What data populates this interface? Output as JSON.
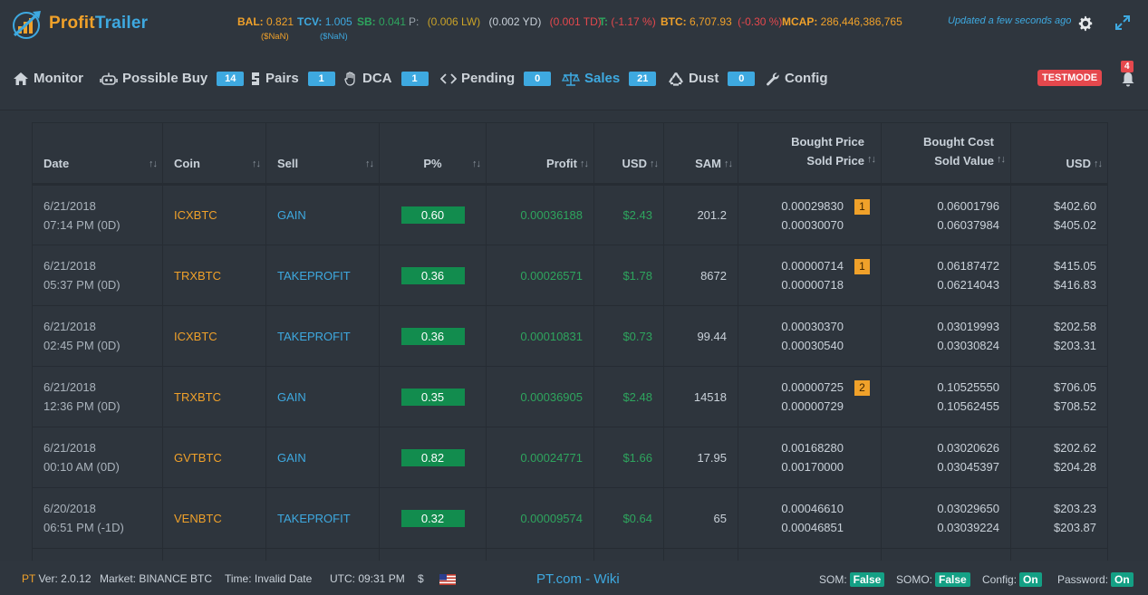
{
  "app": {
    "logo_part1": "Profit",
    "logo_part2": "Trailer",
    "brand_orange": "#f0a12a",
    "brand_blue": "#3ea9e0"
  },
  "header": {
    "bal_label": "BAL:",
    "bal_value": "0.821",
    "bal_sub": "($NaN)",
    "tcv_label": "TCV:",
    "tcv_value": "1.005",
    "tcv_sub": "($NaN)",
    "sb_label": "SB:",
    "sb_value": "0.041",
    "p_label": "P:",
    "p_lw": "(0.006 LW)",
    "p_yd": "(0.002 YD)",
    "p_td": "(0.001 TD)",
    "t_label": "T:",
    "t_value": "(-1.17 %)",
    "btc_label": "BTC:",
    "btc_value": "6,707.93",
    "btc_change": "(-0.30 %)",
    "mcap_label": "MCAP:",
    "mcap_value": "286,446,386,765",
    "updated": "Updated a few seconds ago"
  },
  "nav": {
    "items": [
      {
        "label": "Monitor",
        "badge": null,
        "icon": "home-icon"
      },
      {
        "label": "Possible Buy",
        "badge": "14",
        "icon": "robot-icon"
      },
      {
        "label": "Pairs",
        "badge": "1",
        "icon": "pairs-icon"
      },
      {
        "label": "DCA",
        "badge": "1",
        "icon": "hand-icon"
      },
      {
        "label": "Pending",
        "badge": "0",
        "icon": "pending-icon"
      },
      {
        "label": "Sales",
        "badge": "21",
        "icon": "balance-scale-icon"
      },
      {
        "label": "Dust",
        "badge": "0",
        "icon": "recycle-icon"
      },
      {
        "label": "Config",
        "badge": null,
        "icon": "wrench-icon"
      }
    ],
    "testmode": "TESTMODE",
    "notifications": "4"
  },
  "table": {
    "headers": {
      "date": "Date",
      "coin": "Coin",
      "sell": "Sell",
      "pct": "P%",
      "profit": "Profit",
      "usd": "USD",
      "sam": "SAM",
      "price_top": "Bought Price",
      "price_bottom": "Sold Price",
      "cost_top": "Bought Cost",
      "cost_bottom": "Sold Value",
      "usd2": "USD"
    },
    "rows": [
      {
        "date": "6/21/2018",
        "time": "07:14 PM (0D)",
        "coin": "ICXBTC",
        "sell": "GAIN",
        "pct": "0.60",
        "profit": "0.00036188",
        "usd": "$2.43",
        "sam": "201.2",
        "bought_price": "0.00029830",
        "sold_price": "0.00030070",
        "dca": "1",
        "bought_cost": "0.06001796",
        "sold_value": "0.06037984",
        "usd_bought": "$402.60",
        "usd_sold": "$405.02"
      },
      {
        "date": "6/21/2018",
        "time": "05:37 PM (0D)",
        "coin": "TRXBTC",
        "sell": "TAKEPROFIT",
        "pct": "0.36",
        "profit": "0.00026571",
        "usd": "$1.78",
        "sam": "8672",
        "bought_price": "0.00000714",
        "sold_price": "0.00000718",
        "dca": "1",
        "bought_cost": "0.06187472",
        "sold_value": "0.06214043",
        "usd_bought": "$415.05",
        "usd_sold": "$416.83"
      },
      {
        "date": "6/21/2018",
        "time": "02:45 PM (0D)",
        "coin": "ICXBTC",
        "sell": "TAKEPROFIT",
        "pct": "0.36",
        "profit": "0.00010831",
        "usd": "$0.73",
        "sam": "99.44",
        "bought_price": "0.00030370",
        "sold_price": "0.00030540",
        "dca": null,
        "bought_cost": "0.03019993",
        "sold_value": "0.03030824",
        "usd_bought": "$202.58",
        "usd_sold": "$203.31"
      },
      {
        "date": "6/21/2018",
        "time": "12:36 PM (0D)",
        "coin": "TRXBTC",
        "sell": "GAIN",
        "pct": "0.35",
        "profit": "0.00036905",
        "usd": "$2.48",
        "sam": "14518",
        "bought_price": "0.00000725",
        "sold_price": "0.00000729",
        "dca": "2",
        "bought_cost": "0.10525550",
        "sold_value": "0.10562455",
        "usd_bought": "$706.05",
        "usd_sold": "$708.52"
      },
      {
        "date": "6/21/2018",
        "time": "00:10 AM (0D)",
        "coin": "GVTBTC",
        "sell": "GAIN",
        "pct": "0.82",
        "profit": "0.00024771",
        "usd": "$1.66",
        "sam": "17.95",
        "bought_price": "0.00168280",
        "sold_price": "0.00170000",
        "dca": null,
        "bought_cost": "0.03020626",
        "sold_value": "0.03045397",
        "usd_bought": "$202.62",
        "usd_sold": "$204.28"
      },
      {
        "date": "6/20/2018",
        "time": "06:51 PM (-1D)",
        "coin": "VENBTC",
        "sell": "TAKEPROFIT",
        "pct": "0.32",
        "profit": "0.00009574",
        "usd": "$0.64",
        "sam": "65",
        "bought_price": "0.00046610",
        "sold_price": "0.00046851",
        "dca": null,
        "bought_cost": "0.03029650",
        "sold_value": "0.03039224",
        "usd_bought": "$203.23",
        "usd_sold": "$203.87"
      }
    ]
  },
  "footer": {
    "pt": "PT",
    "version": "Ver: 2.0.12",
    "market": "Market: BINANCE BTC",
    "time": "Time: Invalid Date",
    "utc": "UTC: 09:31 PM",
    "currency": "$",
    "wiki": "PT.com - Wiki",
    "som_label": "SOM:",
    "som_value": "False",
    "somo_label": "SOMO:",
    "somo_value": "False",
    "config_label": "Config:",
    "config_value": "On",
    "password_label": "Password:",
    "password_value": "On"
  }
}
